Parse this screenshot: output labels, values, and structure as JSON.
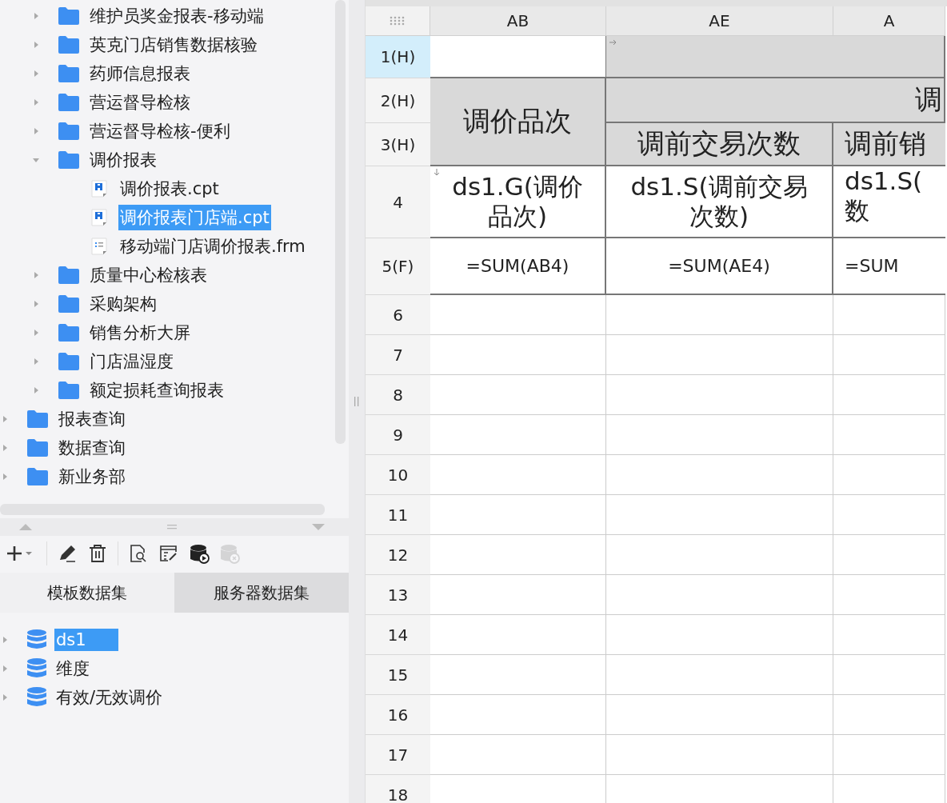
{
  "file_tree": {
    "continued_children": [
      {
        "label": "维护员奖金报表-移动端",
        "expanded": false
      },
      {
        "label": "英克门店销售数据核验",
        "expanded": false
      },
      {
        "label": "药师信息报表",
        "expanded": false
      },
      {
        "label": "营运督导检核",
        "expanded": false
      },
      {
        "label": "营运督导检核-便利",
        "expanded": false
      },
      {
        "label": "调价报表",
        "expanded": true,
        "children": [
          {
            "label": "调价报表.cpt",
            "kind": "cpt",
            "selected": false
          },
          {
            "label": "调价报表门店端.cpt",
            "kind": "cpt",
            "selected": true
          },
          {
            "label": "移动端门店调价报表.frm",
            "kind": "frm",
            "selected": false
          }
        ]
      },
      {
        "label": "质量中心检核表",
        "expanded": false
      },
      {
        "label": "采购架构",
        "expanded": false
      },
      {
        "label": "销售分析大屏",
        "expanded": false
      },
      {
        "label": "门店温湿度",
        "expanded": false
      },
      {
        "label": "额定损耗查询报表",
        "expanded": false
      }
    ],
    "items": [
      {
        "label": "报表查询",
        "expanded": false
      },
      {
        "label": "数据查询",
        "expanded": false
      },
      {
        "label": "新业务部",
        "expanded": false
      }
    ]
  },
  "toolbar": [
    {
      "kind": "add",
      "disabled": false
    },
    {
      "kind": "edit",
      "disabled": false
    },
    {
      "kind": "delete",
      "disabled": false
    },
    {
      "kind": "preview",
      "disabled": false
    },
    {
      "kind": "params",
      "disabled": false
    },
    {
      "kind": "run",
      "disabled": false
    },
    {
      "kind": "remove",
      "disabled": true
    }
  ],
  "dataset_tabs": [
    {
      "label": "模板数据集",
      "selected": true
    },
    {
      "label": "服务器数据集",
      "selected": false
    }
  ],
  "datasets": [
    {
      "label": "ds1",
      "selected": true
    },
    {
      "label": "维度",
      "selected": false
    },
    {
      "label": "有效/无效调价",
      "selected": false
    }
  ],
  "sheet": {
    "columns": [
      "AB",
      "AE",
      "A"
    ],
    "rows": [
      {
        "label": "1(H)",
        "selected": true
      },
      {
        "label": "2(H)",
        "selected": false
      },
      {
        "label": "3(H)",
        "selected": false
      },
      {
        "label": "4",
        "selected": false
      },
      {
        "label": "5(F)",
        "selected": false
      },
      {
        "label": "6",
        "selected": false
      },
      {
        "label": "7",
        "selected": false
      },
      {
        "label": "8",
        "selected": false
      },
      {
        "label": "9",
        "selected": false
      },
      {
        "label": "10",
        "selected": false
      },
      {
        "label": "11",
        "selected": false
      },
      {
        "label": "12",
        "selected": false
      },
      {
        "label": "13",
        "selected": false
      },
      {
        "label": "14",
        "selected": false
      },
      {
        "label": "15",
        "selected": false
      },
      {
        "label": "16",
        "selected": false
      },
      {
        "label": "17",
        "selected": false
      },
      {
        "label": "18",
        "selected": false
      }
    ],
    "header_title": "调价品次",
    "group_title": "调",
    "subheaders": [
      "调前交易次数",
      "调前销"
    ],
    "data_cells": [
      [
        "ds1.G(调价",
        "品次)"
      ],
      [
        "ds1.S(调前交易",
        "次数)"
      ],
      [
        "ds1.S(",
        "数"
      ]
    ],
    "sum_cells": [
      "=SUM(AB4)",
      "=SUM(AE4)",
      "=SUM"
    ]
  }
}
